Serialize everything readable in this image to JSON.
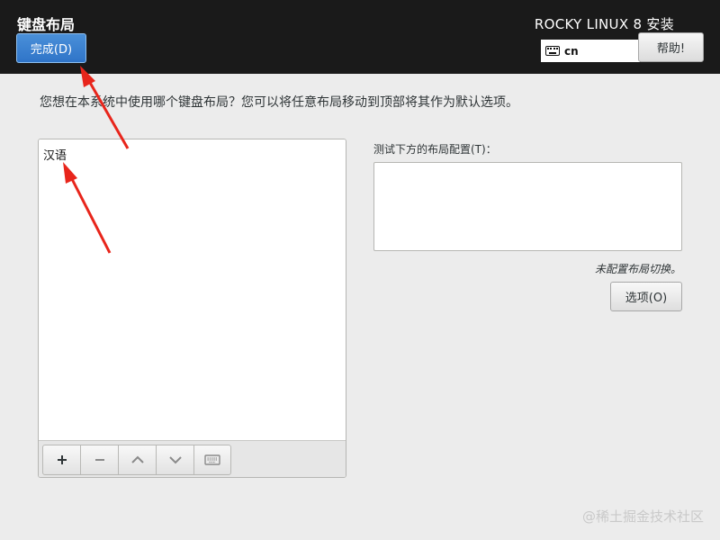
{
  "header": {
    "spoke_title": "键盘布局",
    "done_label": "完成(D)",
    "product_title": "ROCKY LINUX 8 安装",
    "keyboard_indicator": "cn",
    "help_label": "帮助!"
  },
  "main": {
    "question": "您想在本系统中使用哪个键盘布局？您可以将任意布局移动到顶部将其作为默认选项。",
    "layouts": [
      {
        "label": "汉语"
      }
    ],
    "toolbar": {
      "icons": [
        "plus-icon",
        "minus-icon",
        "arrow-up-icon",
        "arrow-down-icon",
        "keyboard-icon"
      ]
    },
    "test_label": "测试下方的布局配置(T)：",
    "test_value": "",
    "switch_note": "未配置布局切换。",
    "options_label": "选项(O)"
  },
  "annotation_color": "#e8251b",
  "watermark": "@稀土掘金技术社区"
}
